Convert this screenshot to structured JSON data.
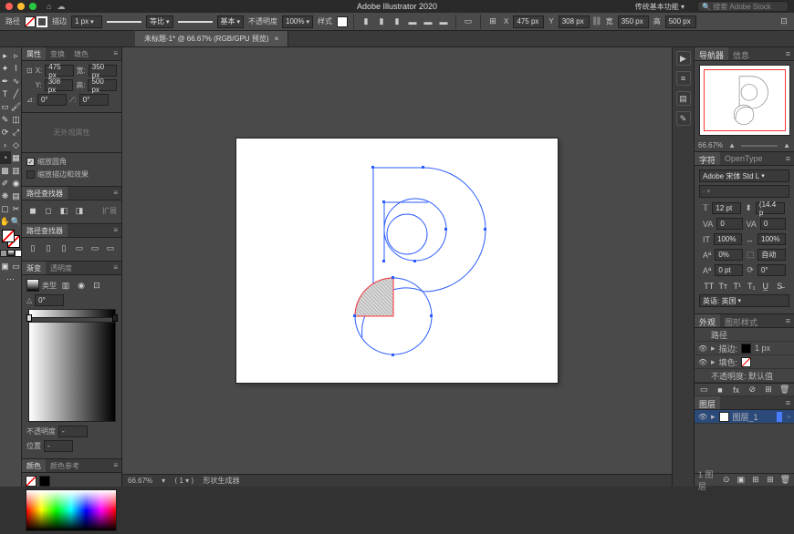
{
  "app": {
    "title": "Adobe Illustrator 2020"
  },
  "workspace": {
    "label": "传统基本功能 ▾"
  },
  "search": {
    "placeholder": "搜索 Adobe Stock"
  },
  "controlbar": {
    "obj_label": "路径",
    "stroke_label": "描边",
    "stroke_w": "1 px",
    "uniform": "等比",
    "basic": "基本",
    "opacity_label": "不透明度",
    "opacity": "100%",
    "style_label": "样式",
    "x_label": "X",
    "x": "475 px",
    "y_label": "Y",
    "y": "308 px",
    "w_label": "宽",
    "w": "350 px",
    "h_label": "高",
    "h": "500 px"
  },
  "doc_tab": {
    "title": "未标题-1* @ 66.67% (RGB/GPU 预览)"
  },
  "transform_panel": {
    "tabs": [
      "属性",
      "变换",
      "填色"
    ],
    "x": "475 px",
    "y": "308 px",
    "w": "350 px",
    "h": "500 px",
    "angle": "0°",
    "scale_corners": "缩放圆角",
    "scale_strokes": "缩放描边和效果",
    "no_appearance": "无外观属性"
  },
  "pathfinder_panel": {
    "tabs": [
      "路径查找器"
    ],
    "hint": "扩展"
  },
  "align_panel": {
    "tabs": [
      "路径查找器"
    ]
  },
  "gradient_panel": {
    "tabs": [
      "渐变",
      "透明度"
    ],
    "type_label": "类型",
    "angle": "0°",
    "opacity_label": "不透明度",
    "opacity": "-",
    "pos_label": "位置",
    "pos": "-"
  },
  "color_panel": {
    "tabs": [
      "颜色",
      "颜色参考"
    ]
  },
  "navigator": {
    "tabs": [
      "导航器",
      "信息"
    ],
    "zoom": "66.67%"
  },
  "char_panel": {
    "tabs": [
      "字符",
      "OpenType"
    ],
    "font": "Adobe 宋体 Std L",
    "size": "12 pt",
    "leading": "(14.4 p",
    "tracking": "0",
    "kerning": "0",
    "vscale": "100%",
    "hscale": "100%",
    "baseline": "自动",
    "alt": "0%",
    "rotate": "0 pt",
    "rot2": "0°",
    "lang": "英语: 英国"
  },
  "appearance_panel": {
    "tabs": [
      "外观",
      "图形样式"
    ],
    "rows": [
      {
        "label": "路径"
      },
      {
        "label": "描边:",
        "value": "1 px"
      },
      {
        "label": "填色:"
      },
      {
        "label": "不透明度: 默认值"
      }
    ]
  },
  "layers_panel": {
    "tabs": [
      "图层"
    ],
    "rows": [
      {
        "name": "图层_1"
      }
    ]
  },
  "status": {
    "zoom": "66.67%",
    "tool": "形状生成器"
  }
}
